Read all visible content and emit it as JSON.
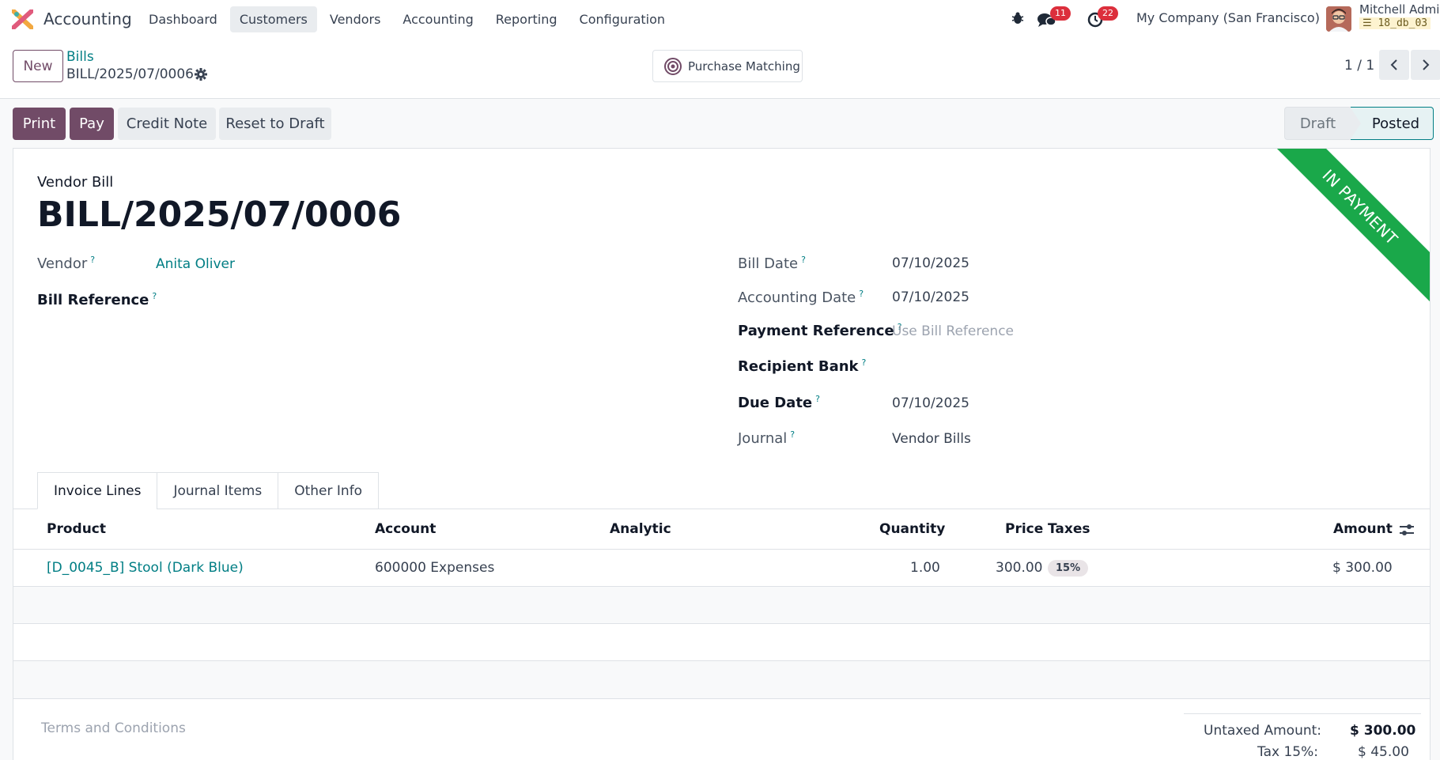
{
  "navbar": {
    "app_name": "Accounting",
    "menu": [
      "Dashboard",
      "Customers",
      "Vendors",
      "Accounting",
      "Reporting",
      "Configuration"
    ],
    "active_menu": "Customers",
    "messages_count": "11",
    "activities_count": "22",
    "company": "My Company (San Francisco)",
    "user_name": "Mitchell Admin",
    "db_name": "18_db_03"
  },
  "control_panel": {
    "new_label": "New",
    "breadcrumb_parent": "Bills",
    "breadcrumb_current": "BILL/2025/07/0006",
    "purchase_matching_label": "Purchase Matching",
    "pager": "1 / 1"
  },
  "actions": {
    "print": "Print",
    "pay": "Pay",
    "credit_note": "Credit Note",
    "reset_to_draft": "Reset to Draft"
  },
  "status": {
    "draft": "Draft",
    "posted": "Posted",
    "current": "Posted"
  },
  "ribbon": "IN PAYMENT",
  "document": {
    "type": "Vendor Bill",
    "name": "BILL/2025/07/0006"
  },
  "fields": {
    "vendor_label": "Vendor",
    "vendor_value": "Anita Oliver",
    "bill_reference_label": "Bill Reference",
    "bill_date_label": "Bill Date",
    "bill_date_value": "07/10/2025",
    "accounting_date_label": "Accounting Date",
    "accounting_date_value": "07/10/2025",
    "payment_reference_label": "Payment Reference",
    "payment_reference_placeholder": "Use Bill Reference",
    "recipient_bank_label": "Recipient Bank",
    "due_date_label": "Due Date",
    "due_date_value": "07/10/2025",
    "journal_label": "Journal",
    "journal_value": "Vendor Bills",
    "help_mark": "?"
  },
  "tabs": [
    "Invoice Lines",
    "Journal Items",
    "Other Info"
  ],
  "lines": {
    "headers": {
      "product": "Product",
      "account": "Account",
      "analytic": "Analytic",
      "quantity": "Quantity",
      "price": "Price",
      "taxes": "Taxes",
      "amount": "Amount"
    },
    "rows": [
      {
        "product": "[D_0045_B] Stool (Dark Blue)",
        "account": "600000 Expenses",
        "analytic": "",
        "quantity": "1.00",
        "price": "300.00",
        "taxes": "15%",
        "amount": "$ 300.00"
      }
    ]
  },
  "footer": {
    "terms_placeholder": "Terms and Conditions",
    "untaxed_label": "Untaxed Amount:",
    "untaxed_value": "$ 300.00",
    "tax_label": "Tax 15%:",
    "tax_value": "$ 45.00"
  },
  "colors": {
    "primary": "#714b67",
    "link": "#017e84",
    "ribbon": "#1aa84a",
    "badge": "#dc2f3c"
  }
}
